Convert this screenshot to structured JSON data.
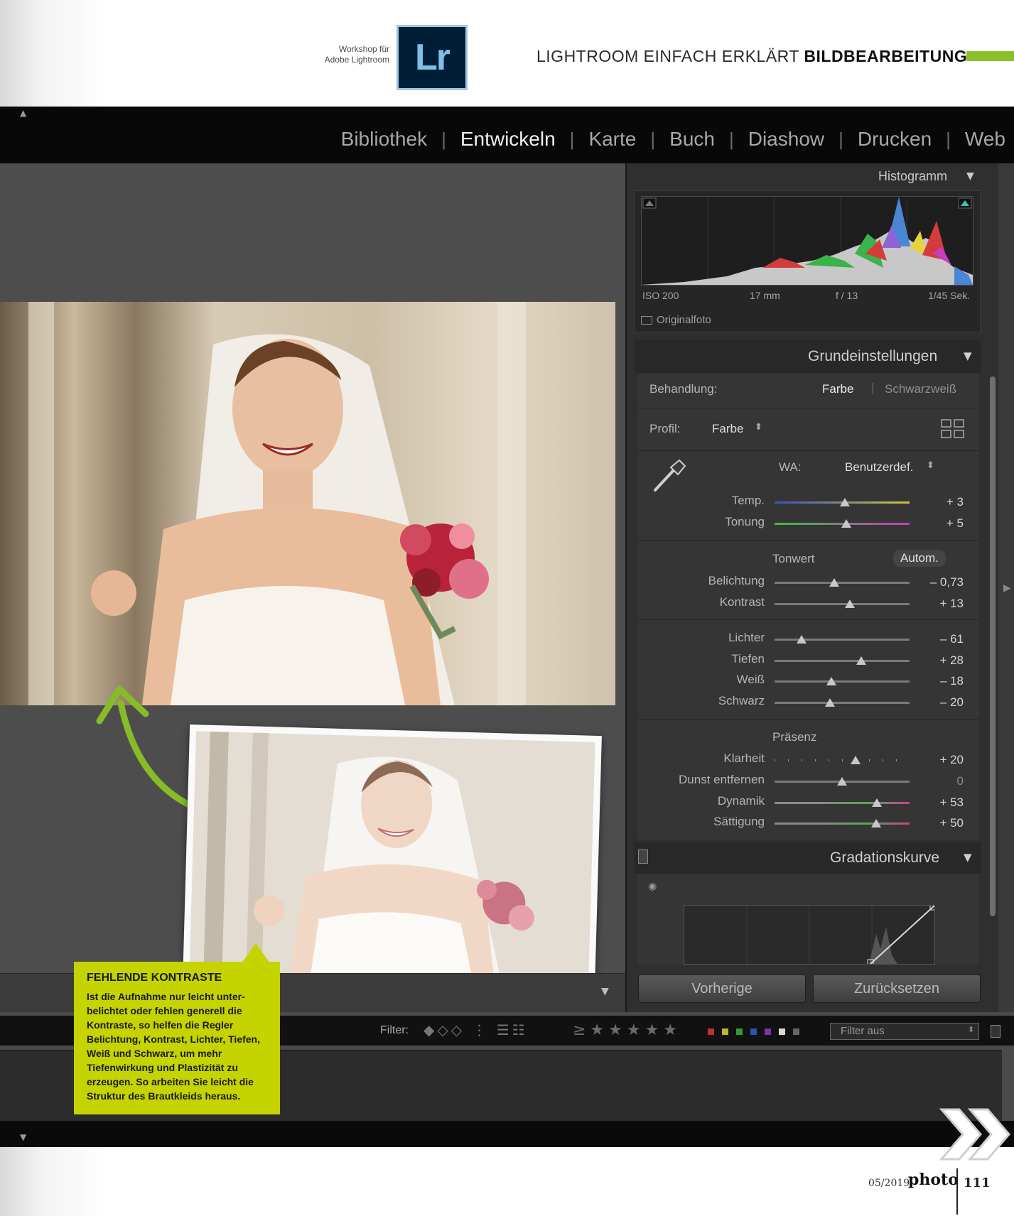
{
  "magazine": {
    "workshop_line1": "Workshop für",
    "workshop_line2": "Adobe Lightroom",
    "logo_text": "Lr",
    "header_regular": "LIGHTROOM EINFACH ERKLÄRT",
    "header_bold": "BILDBEARBEITUNG",
    "accent_color": "#8cc02b",
    "footer_date": "05/2019",
    "footer_logo": "photo",
    "page_number": "111"
  },
  "modules": {
    "bibliothek": "Bibliothek",
    "entwickeln": "Entwickeln",
    "karte": "Karte",
    "buch": "Buch",
    "diashow": "Diashow",
    "drucken": "Drucken",
    "web": "Web",
    "separator": "|"
  },
  "histogram": {
    "title": "Histogramm",
    "iso": "ISO 200",
    "focal": "17 mm",
    "aperture": "f / 13",
    "shutter": "1/45 Sek.",
    "original_label": "Originalfoto"
  },
  "basic": {
    "title": "Grundeinstellungen",
    "treatment_label": "Behandlung:",
    "treatment_color": "Farbe",
    "treatment_bw": "Schwarzweiß",
    "profile_label": "Profil:",
    "profile_value": "Farbe",
    "wb_label": "WA:",
    "wb_value": "Benutzerdef.",
    "tone_label": "Tonwert",
    "auto_label": "Autom.",
    "presence_label": "Präsenz",
    "sliders": {
      "temp": {
        "label": "Temp.",
        "value": "+ 3",
        "pos": 0.52
      },
      "tint": {
        "label": "Tonung",
        "value": "+ 5",
        "pos": 0.53
      },
      "exposure": {
        "label": "Belichtung",
        "value": "– 0,73",
        "pos": 0.44
      },
      "contrast": {
        "label": "Kontrast",
        "value": "+ 13",
        "pos": 0.56
      },
      "highlights": {
        "label": "Lichter",
        "value": "– 61",
        "pos": 0.2
      },
      "shadows": {
        "label": "Tiefen",
        "value": "+ 28",
        "pos": 0.64
      },
      "whites": {
        "label": "Weiß",
        "value": "– 18",
        "pos": 0.42
      },
      "blacks": {
        "label": "Schwarz",
        "value": "– 20",
        "pos": 0.41
      },
      "clarity": {
        "label": "Klarheit",
        "value": "+ 20",
        "pos": 0.6
      },
      "dehaze": {
        "label": "Dunst entfernen",
        "value": "0",
        "pos": 0.5
      },
      "vibrance": {
        "label": "Dynamik",
        "value": "+ 53",
        "pos": 0.76
      },
      "saturation": {
        "label": "Sättigung",
        "value": "+ 50",
        "pos": 0.75
      }
    }
  },
  "curve": {
    "title": "Gradationskurve"
  },
  "buttons": {
    "previous": "Vorherige",
    "reset": "Zurücksetzen"
  },
  "filter": {
    "label": "Filter:",
    "select_value": "Filter aus"
  },
  "callout": {
    "title": "FEHLENDE KONTRASTE",
    "body": "Ist die Aufnahme nur leicht unter­belichtet oder fehlen generell die Kontraste, so helfen die Regler Belichtung, Kontrast, Lichter, Tie­fen, Weiß und Schwarz, um mehr Tiefenwirkung und Plastizität zu erzeugen. So arbeiten Sie leicht die Struktur des Brautkleids heraus.",
    "background": "#c5d300"
  }
}
